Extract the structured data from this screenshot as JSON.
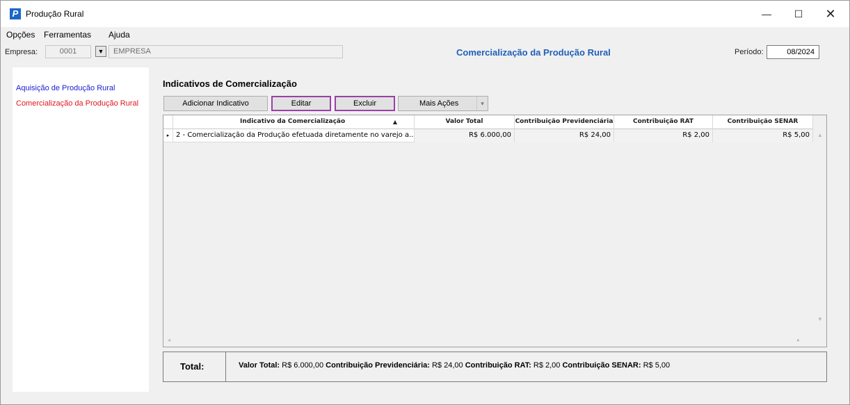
{
  "window": {
    "title": "Produção Rural",
    "icon_letter": "P",
    "controls": {
      "minimize": "—",
      "maximize": "☐",
      "close": "✕"
    }
  },
  "menu": {
    "items": [
      "Opções",
      "Ferramentas",
      "Ajuda"
    ]
  },
  "company": {
    "label": "Empresa:",
    "code": "0001",
    "dropdown_glyph": "▼",
    "name": "EMPRESA",
    "header": "Comercialização da Produção Rural",
    "period_label": "Período:",
    "period_value": "08/2024"
  },
  "sidebar": {
    "items": [
      {
        "label": "Aquisição de Produção Rural",
        "color": "#1a1ad6"
      },
      {
        "label": "Comercialização da Produção Rural",
        "color": "#e0141e"
      }
    ]
  },
  "section": {
    "title": "Indicativos de Comercialização"
  },
  "toolbar": {
    "add_label": "Adicionar Indicativo",
    "edit_label": "Editar",
    "delete_label": "Excluir",
    "more_label": "Mais Ações",
    "more_caret": "▾"
  },
  "grid": {
    "columns": [
      "Indicativo da Comercialização",
      "Valor Total",
      "Contribuição Previdenciária",
      "Contribuição RAT",
      "Contribuição SENAR"
    ],
    "sort_glyph": "▲",
    "rows": [
      {
        "indicator": "▸",
        "indicativo": "2 - Comercialização da Produção efetuada diretamente no varejo a...",
        "valor_total": "R$ 6.000,00",
        "contrib_prev": "R$ 24,00",
        "contrib_rat": "R$ 2,00",
        "contrib_senar": "R$ 5,00"
      }
    ],
    "scroll": {
      "up": "▲",
      "down": "▼",
      "left": "◂",
      "right": "▸"
    }
  },
  "totals": {
    "label": "Total:",
    "valor_total_label": "Valor Total:",
    "valor_total": "R$ 6.000,00",
    "contrib_prev_label": "Contribuição Previdenciária:",
    "contrib_prev": "R$ 24,00",
    "contrib_rat_label": "Contribuição RAT:",
    "contrib_rat": "R$ 2,00",
    "contrib_senar_label": "Contribuição SENAR:",
    "contrib_senar": "R$ 5,00"
  },
  "colors": {
    "header_blue": "#1f5fb8",
    "highlight_border": "#9b3fa7"
  }
}
